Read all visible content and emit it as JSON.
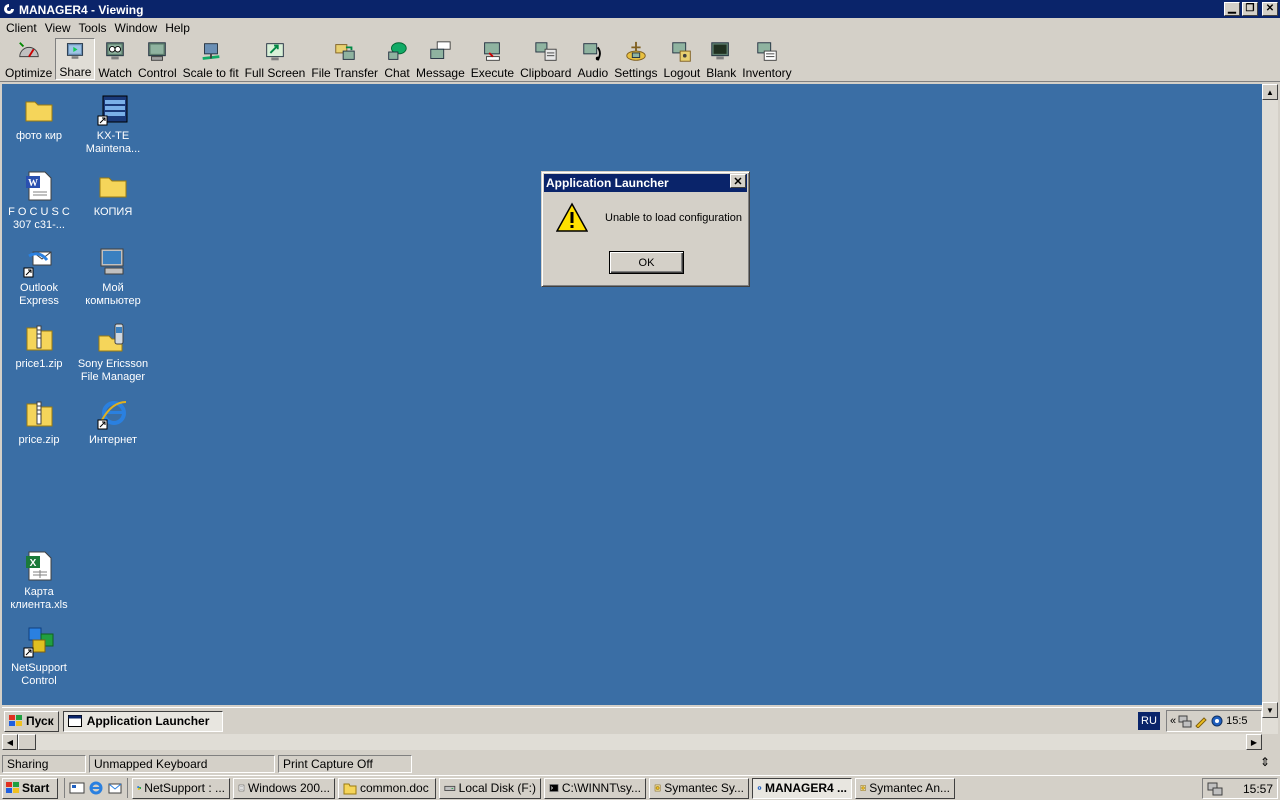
{
  "window": {
    "title": "MANAGER4 - Viewing"
  },
  "menu": [
    "Client",
    "View",
    "Tools",
    "Window",
    "Help"
  ],
  "toolbar": [
    {
      "label": "Optimize",
      "icon": "optimize-icon"
    },
    {
      "label": "Share",
      "icon": "share-icon",
      "pressed": true
    },
    {
      "label": "Watch",
      "icon": "watch-icon"
    },
    {
      "label": "Control",
      "icon": "control-icon"
    },
    {
      "label": "Scale to fit",
      "icon": "scale-icon"
    },
    {
      "label": "Full Screen",
      "icon": "fullscreen-icon"
    },
    {
      "label": "File Transfer",
      "icon": "file-transfer-icon"
    },
    {
      "label": "Chat",
      "icon": "chat-icon"
    },
    {
      "label": "Message",
      "icon": "message-icon"
    },
    {
      "label": "Execute",
      "icon": "execute-icon"
    },
    {
      "label": "Clipboard",
      "icon": "clipboard-icon"
    },
    {
      "label": "Audio",
      "icon": "audio-icon"
    },
    {
      "label": "Settings",
      "icon": "settings-icon"
    },
    {
      "label": "Logout",
      "icon": "logout-icon"
    },
    {
      "label": "Blank",
      "icon": "blank-icon"
    },
    {
      "label": "Inventory",
      "icon": "inventory-icon"
    }
  ],
  "desktop_icons": [
    {
      "label": "фото кир",
      "icon": "folder-icon"
    },
    {
      "label": "KX-TE Maintena...",
      "icon": "shortcut-app-icon"
    },
    {
      "label": "F O C U S C 307 c31-...",
      "icon": "word-doc-icon"
    },
    {
      "label": "КОПИЯ",
      "icon": "folder-icon"
    },
    {
      "label": "Outlook Express",
      "icon": "outlook-icon"
    },
    {
      "label": "Мой компьютер",
      "icon": "my-computer-icon"
    },
    {
      "label": "price1.zip",
      "icon": "zip-icon"
    },
    {
      "label": "Sony Ericsson File Manager",
      "icon": "phone-icon"
    },
    {
      "label": "price.zip",
      "icon": "zip-icon"
    },
    {
      "label": "Интернет",
      "icon": "ie-icon"
    },
    {
      "label": "Карта клиента.xls",
      "icon": "excel-icon"
    },
    {
      "label": "NetSupport Control",
      "icon": "netsupport-icon"
    }
  ],
  "dialog": {
    "title": "Application Launcher",
    "message": "Unable to load configuration",
    "ok_label": "OK"
  },
  "remote_taskbar": {
    "start_label": "Пуск",
    "active_task": "Application Launcher",
    "lang": "RU",
    "tray_chevron": "«",
    "clock": "15:5"
  },
  "status": [
    "Sharing",
    "Unmapped Keyboard",
    "Print Capture Off"
  ],
  "taskbar": {
    "start_label": "Start",
    "tasks": [
      {
        "label": "NetSupport : ...",
        "active": false
      },
      {
        "label": "Windows 200...",
        "active": false
      },
      {
        "label": "common.doc",
        "active": false
      },
      {
        "label": "Local Disk (F:)",
        "active": false
      },
      {
        "label": "C:\\WINNT\\sy...",
        "active": false
      },
      {
        "label": "Symantec Sy...",
        "active": false
      },
      {
        "label": "MANAGER4 ...",
        "active": true
      },
      {
        "label": "Symantec An...",
        "active": false
      }
    ],
    "clock": "15:57"
  }
}
